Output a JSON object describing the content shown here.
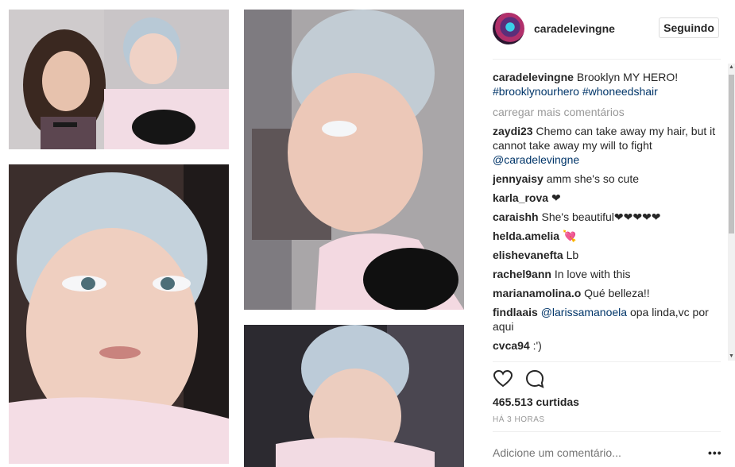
{
  "post": {
    "username": "caradelevingne",
    "follow_label": "Seguindo",
    "caption": {
      "user": "caradelevingne",
      "text": "Brooklyn MY HERO!",
      "hashtags": "#brooklynourhero #whoneedshair"
    },
    "load_more": "carregar mais comentários",
    "comments": [
      {
        "user": "zaydi23",
        "text": "Chemo can take away my hair, but it cannot take away my will to fight",
        "mention": "@caradelevingne"
      },
      {
        "user": "jennyaisy",
        "text": "amm she's so cute",
        "mention": ""
      },
      {
        "user": "karla_rova",
        "text": "❤",
        "mention": ""
      },
      {
        "user": "caraishh",
        "text": "She's beautiful❤❤❤❤❤",
        "mention": ""
      },
      {
        "user": "helda.amelia",
        "text": "💘",
        "mention": ""
      },
      {
        "user": "elishevanefta",
        "text": "Lb",
        "mention": ""
      },
      {
        "user": "rachel9ann",
        "text": "In love with this",
        "mention": ""
      },
      {
        "user": "marianamolina.o",
        "text": "Qué belleza!!",
        "mention": ""
      },
      {
        "user": "findlaais",
        "text": "opa linda,vc por aqui",
        "mention": "@larissamanoela"
      },
      {
        "user": "cvca94",
        "text": ":')",
        "mention": ""
      }
    ],
    "likes": "465.513 curtidas",
    "time": "HÁ 3 HORAS",
    "add_comment_placeholder": "Adicione um comentário...",
    "more_label": "•••"
  },
  "icons": [
    "heart-icon",
    "comment-icon",
    "avatar"
  ],
  "colors": {
    "link": "#003569",
    "muted": "#999999",
    "text": "#262626",
    "border": "#efefef"
  }
}
